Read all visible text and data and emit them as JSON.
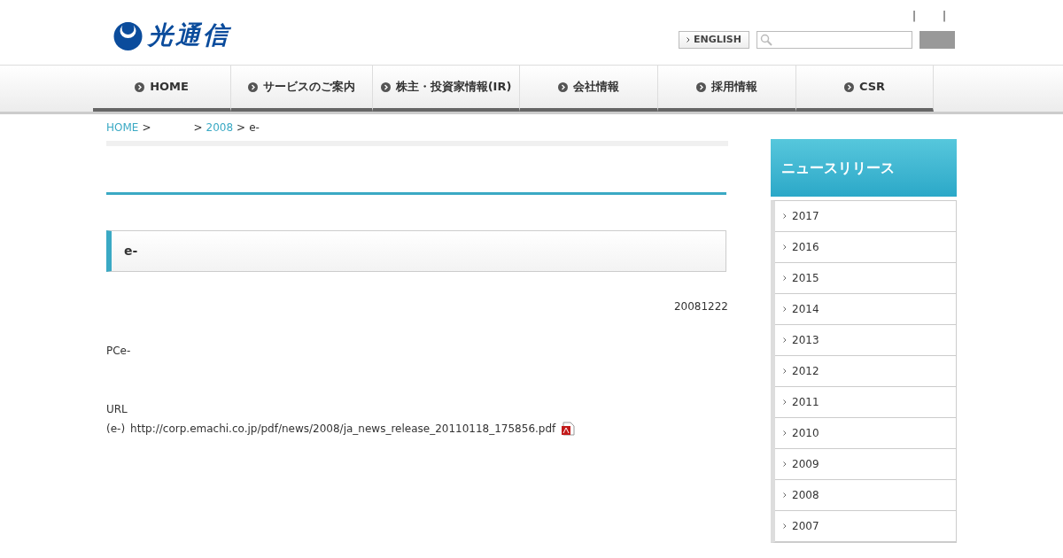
{
  "header": {
    "logo": "光通信",
    "separators": [
      "|",
      "|"
    ],
    "english_button": "ENGLISH"
  },
  "nav": [
    {
      "label": "HOME"
    },
    {
      "label": "サービスのご案内"
    },
    {
      "label": "株主・投資家情報(IR)"
    },
    {
      "label": "会社情報"
    },
    {
      "label": "採用情報"
    },
    {
      "label": "CSR"
    }
  ],
  "breadcrumb": [
    {
      "label": "HOME",
      "kind": "link"
    },
    {
      "label": ">",
      "kind": "separator"
    },
    {
      "label": ">",
      "kind": "separator"
    },
    {
      "label": "2008",
      "kind": "link"
    },
    {
      "label": ">",
      "kind": "separator"
    },
    {
      "label": "e-",
      "kind": "current"
    }
  ],
  "article": {
    "heading": "e-",
    "date": "20081222",
    "body": "PCe-",
    "url_label": "URL",
    "link_prefix": "(e-)",
    "link": "http://corp.emachi.co.jp/pdf/news/2008/ja_news_release_20110118_175856.pdf"
  },
  "sidebar": {
    "title": "ニュースリリース",
    "items": [
      {
        "label": "2017"
      },
      {
        "label": "2016"
      },
      {
        "label": "2015"
      },
      {
        "label": "2014"
      },
      {
        "label": "2013"
      },
      {
        "label": "2012"
      },
      {
        "label": "2011"
      },
      {
        "label": "2010"
      },
      {
        "label": "2009"
      },
      {
        "label": "2008"
      },
      {
        "label": "2007"
      }
    ]
  }
}
